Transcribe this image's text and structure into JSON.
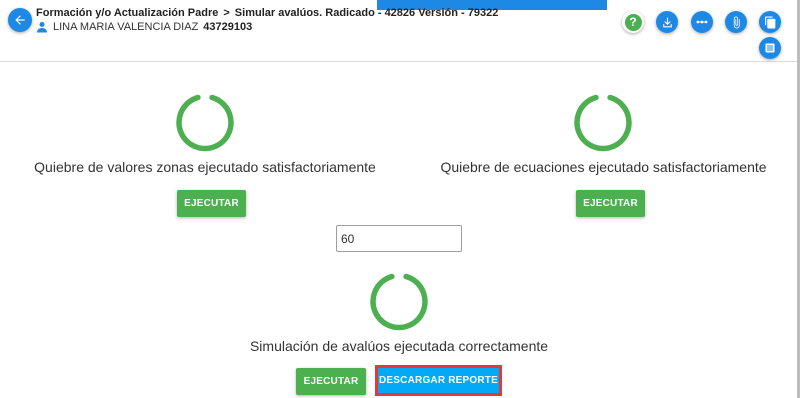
{
  "header": {
    "breadcrumb": [
      "Formación y/o Actualización Padre",
      "Simular avalúos. Radicado - 42826 Versión - 79322"
    ],
    "breadcrumb_separator": ">",
    "user_name": "LINA MARIA VALENCIA DIAZ",
    "user_id": "43729103",
    "toolbar_icons": [
      "help-icon",
      "download-icon",
      "more-horizontal-icon",
      "attach-icon",
      "copy-icon",
      "list-icon"
    ]
  },
  "sections": {
    "zonas": {
      "message": "Quiebre de valores zonas ejecutado satisfactoriamente",
      "button_label": "EJECUTAR",
      "status_icon": "success-ring-icon"
    },
    "ecuaciones": {
      "message": "Quiebre de ecuaciones ejecutado satisfactoriamente",
      "button_label": "EJECUTAR",
      "status_icon": "success-ring-icon"
    },
    "simulacion": {
      "input_value": "60",
      "message": "Simulación de avalúos ejecutada correctamente",
      "execute_label": "EJECUTAR",
      "download_label": "DESCARGAR REPORTE",
      "status_icon": "success-ring-icon"
    }
  },
  "colors": {
    "primary": "#1e88e5",
    "success": "#4caf50",
    "download": "#03a9f4",
    "highlight": "#e53935"
  }
}
